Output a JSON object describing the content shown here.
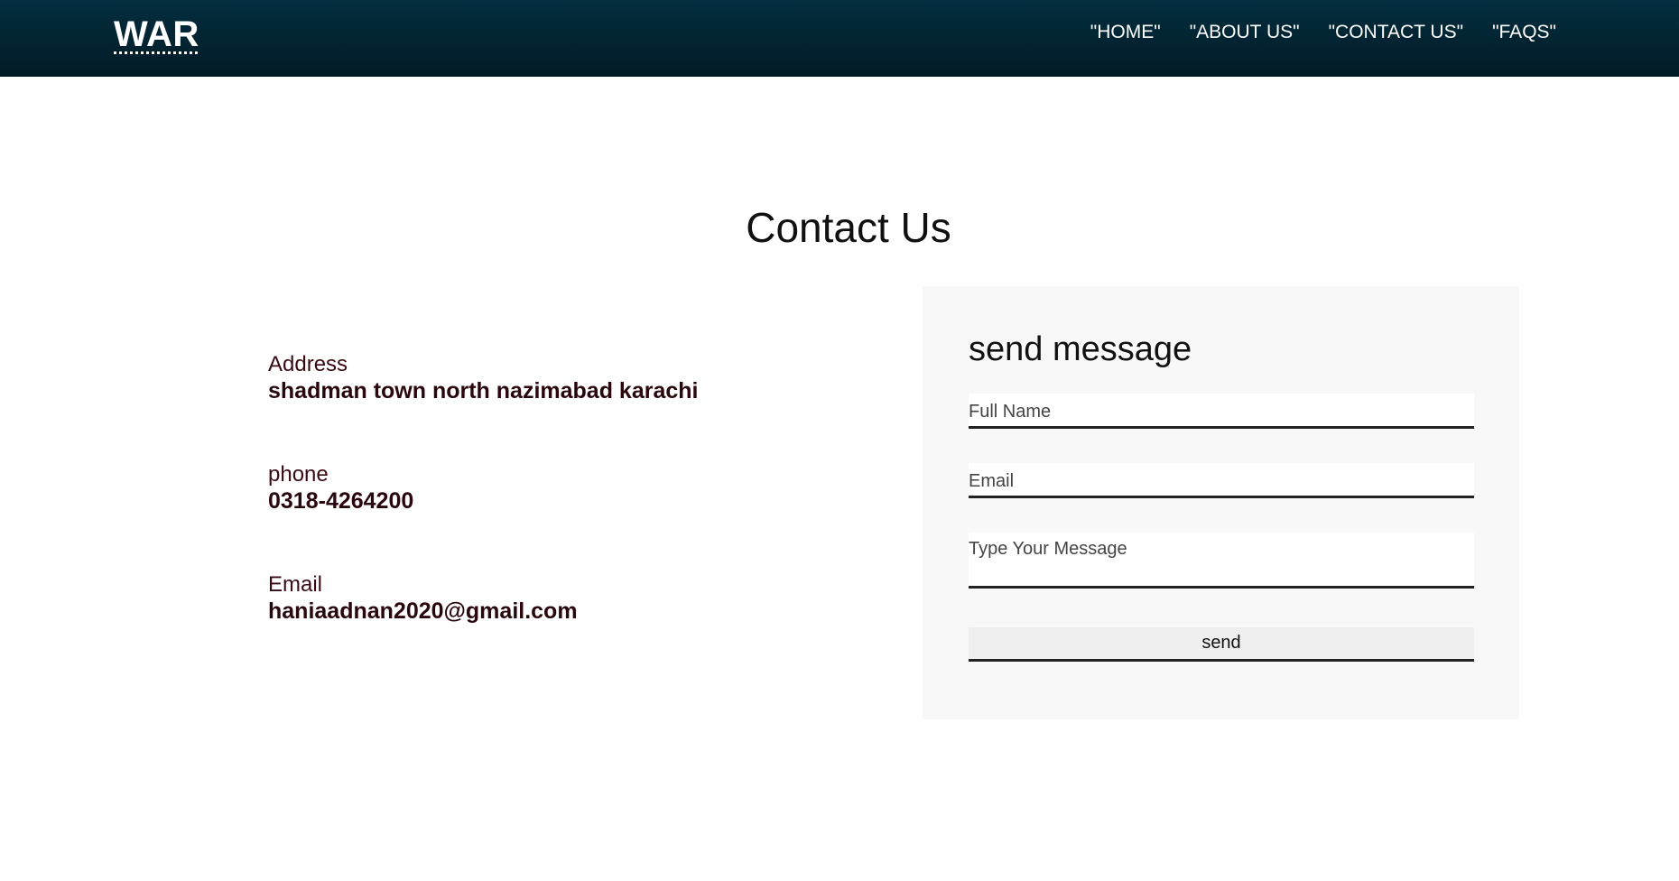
{
  "header": {
    "logo": "WAR",
    "nav": [
      "\"HOME\"",
      "\"ABOUT US\"",
      "\"CONTACT US\"",
      "\"FAQS\""
    ]
  },
  "page": {
    "title": "Contact Us"
  },
  "contact_info": {
    "address": {
      "label": "Address",
      "value": "shadman town north nazimabad karachi"
    },
    "phone": {
      "label": "phone",
      "value": "0318-4264200"
    },
    "email": {
      "label": "Email",
      "value": "haniaadnan2020@gmail.com"
    }
  },
  "form": {
    "title": "send message",
    "full_name_placeholder": "Full Name",
    "email_placeholder": "Email",
    "message_placeholder": "Type Your Message",
    "send_label": "send"
  },
  "colors": {
    "header_bg": "#032e3f",
    "text_dark_red": "#2a070d",
    "form_bg": "#f8f8f8"
  }
}
